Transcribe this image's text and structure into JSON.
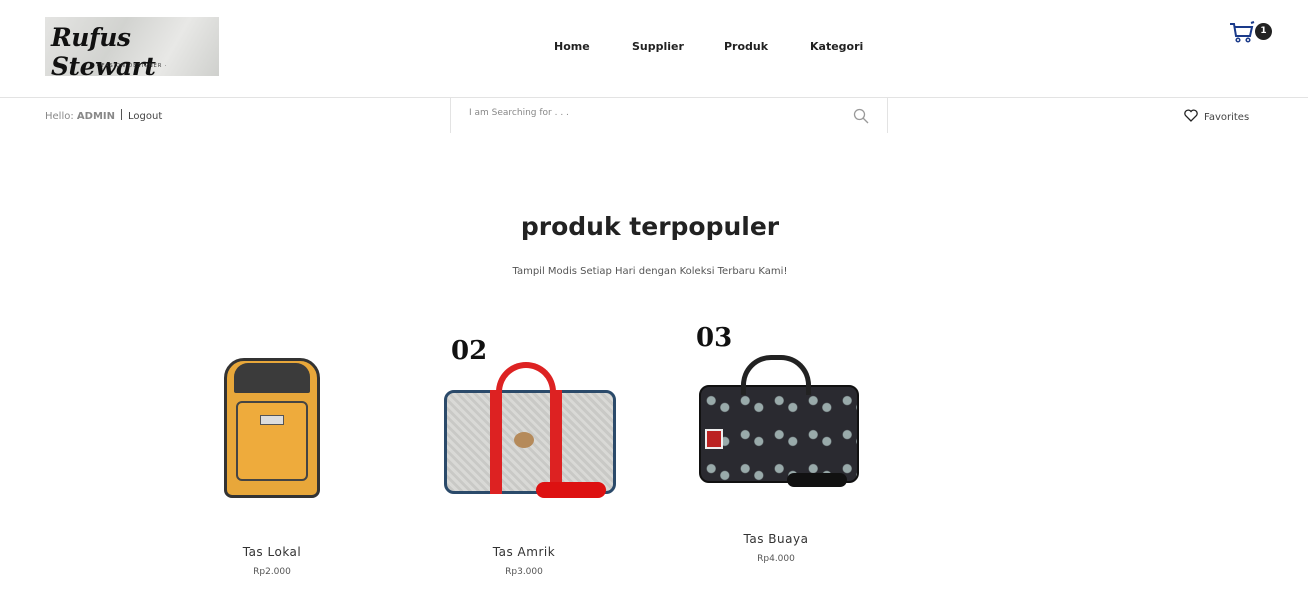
{
  "brand": {
    "name": "Rufus Stewart",
    "tagline": "· FASION DESIGNER ·"
  },
  "nav": [
    "Home",
    "Supplier",
    "Produk",
    "Kategori"
  ],
  "cart": {
    "count": "1"
  },
  "user": {
    "hello": "Hello:",
    "name": "ADMIN",
    "logout": "Logout"
  },
  "search": {
    "placeholder": "I am Searching for . . ."
  },
  "favorites": "Favorites",
  "section": {
    "title": "produk terpopuler",
    "subtitle": "Tampil Modis Setiap Hari dengan Koleksi Terbaru Kami!"
  },
  "products": [
    {
      "rank": "",
      "name": "Tas Lokal",
      "price": "Rp2.000"
    },
    {
      "rank": "02",
      "name": "Tas Amrik",
      "price": "Rp3.000"
    },
    {
      "rank": "03",
      "name": "Tas Buaya",
      "price": "Rp4.000"
    }
  ]
}
